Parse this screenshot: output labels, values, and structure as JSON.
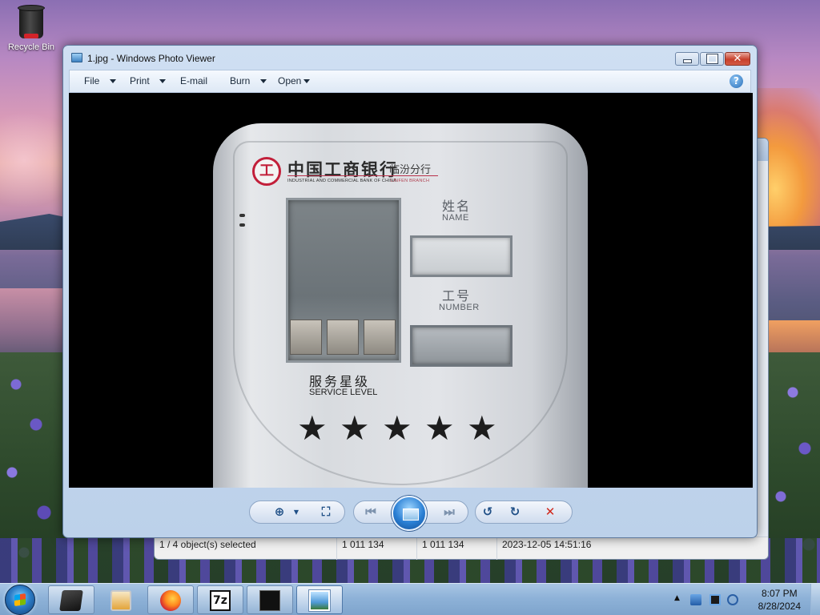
{
  "desktop": {
    "icons": [
      {
        "label": "Recycle Bin",
        "icon": "recycle-bin-icon"
      }
    ]
  },
  "background_window": {
    "status": {
      "selected": "1 / 4 object(s) selected",
      "size_a": "1 011 134",
      "size_b": "1 011 134",
      "date": "2023-12-05 14:51:16"
    }
  },
  "photo_viewer": {
    "title": "1.jpg - Windows Photo Viewer",
    "menu": [
      {
        "label": "File",
        "has_dropdown": true
      },
      {
        "label": "Print",
        "has_dropdown": true
      },
      {
        "label": "E-mail",
        "has_dropdown": false
      },
      {
        "label": "Burn",
        "has_dropdown": true
      },
      {
        "label": "Open",
        "has_dropdown": true
      }
    ],
    "help_label": "?",
    "photo": {
      "bank_name_cn": "中国工商银行",
      "branch_cn": "临汾分行",
      "bank_name_en": "INDUSTRIAL AND COMMERCIAL BANK OF CHINA",
      "branch_en": "LINFEN BRANCH",
      "name_cn": "姓名",
      "name_en": "NAME",
      "number_cn": "工号",
      "number_en": "NUMBER",
      "service_cn": "服务星级",
      "service_en": "SERVICE LEVEL",
      "stars": 5,
      "star_glyph": "★"
    },
    "controls": [
      "zoom-icon",
      "actual-size-icon",
      "previous-icon",
      "slideshow-icon",
      "next-icon",
      "rotate-counterclockwise-icon",
      "rotate-clockwise-icon",
      "delete-icon"
    ]
  },
  "taskbar": {
    "pinned": [
      "start-orb",
      "app-icon",
      "media-player-icon",
      "firefox-icon",
      "7zip-icon",
      "terminal-icon",
      "photo-viewer-icon"
    ],
    "seven_zip_label": "7z",
    "clock_time": "8:07 PM",
    "clock_date": "8/28/2024"
  },
  "colors": {
    "taskbar": "#8eb2d8",
    "window_frame": "#bcd1ea",
    "close_button": "#c7402c",
    "accent_blue": "#2a7fd4",
    "bank_red": "#c21f3a"
  }
}
